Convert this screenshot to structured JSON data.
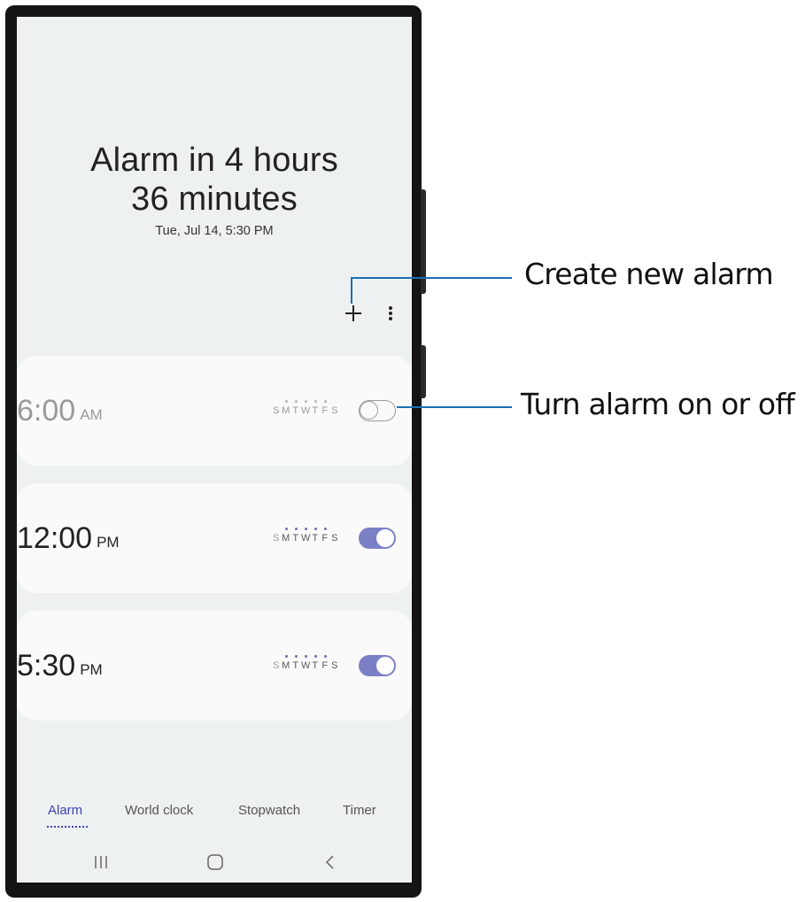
{
  "header": {
    "line1": "Alarm in 4 hours",
    "line2": "36 minutes",
    "subtitle": "Tue, Jul 14, 5:30 PM"
  },
  "toolbar": {
    "add_icon": "plus-icon",
    "more_icon": "more-vert-icon"
  },
  "alarms": [
    {
      "time": "6:00",
      "ampm": "AM",
      "enabled": false,
      "days": [
        {
          "label": "S",
          "dot": false
        },
        {
          "label": "M",
          "dot": true
        },
        {
          "label": "T",
          "dot": true
        },
        {
          "label": "W",
          "dot": true
        },
        {
          "label": "T",
          "dot": true
        },
        {
          "label": "F",
          "dot": true
        },
        {
          "label": "S",
          "dot": false
        }
      ]
    },
    {
      "time": "12:00",
      "ampm": "PM",
      "enabled": true,
      "days": [
        {
          "label": "S",
          "dot": false
        },
        {
          "label": "M",
          "dot": true
        },
        {
          "label": "T",
          "dot": true
        },
        {
          "label": "W",
          "dot": true
        },
        {
          "label": "T",
          "dot": true
        },
        {
          "label": "F",
          "dot": true
        },
        {
          "label": "S",
          "dot": false
        }
      ]
    },
    {
      "time": "5:30",
      "ampm": "PM",
      "enabled": true,
      "days": [
        {
          "label": "S",
          "dot": false
        },
        {
          "label": "M",
          "dot": true
        },
        {
          "label": "T",
          "dot": true
        },
        {
          "label": "W",
          "dot": true
        },
        {
          "label": "T",
          "dot": true
        },
        {
          "label": "F",
          "dot": true
        },
        {
          "label": "S",
          "dot": false
        }
      ]
    }
  ],
  "tabs": [
    {
      "label": "Alarm",
      "active": true
    },
    {
      "label": "World clock",
      "active": false
    },
    {
      "label": "Stopwatch",
      "active": false
    },
    {
      "label": "Timer",
      "active": false
    }
  ],
  "nav": {
    "recents_icon": "recents-icon",
    "home_icon": "home-icon",
    "back_icon": "back-icon"
  },
  "callouts": {
    "create": "Create new alarm",
    "toggle": "Turn alarm on or off"
  },
  "colors": {
    "accent": "#7b7fc6",
    "tab_active": "#3b45b0",
    "callout_line": "#1a6fb5"
  }
}
